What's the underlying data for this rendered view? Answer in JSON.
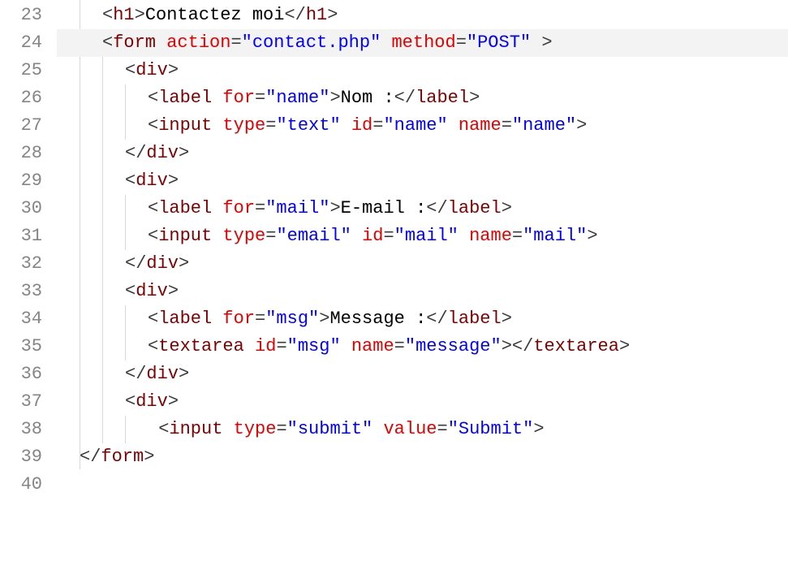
{
  "gutter": {
    "start": 23,
    "end": 40
  },
  "highlightedLine": 24,
  "guideOffsets": [
    28,
    56,
    84,
    112
  ],
  "lines": [
    {
      "n": 23,
      "indent": 2,
      "guides": [
        1
      ],
      "tokens": [
        {
          "c": "punct",
          "t": "<"
        },
        {
          "c": "tag",
          "t": "h1"
        },
        {
          "c": "punct",
          "t": ">"
        },
        {
          "c": "text",
          "t": "Contactez moi"
        },
        {
          "c": "punct",
          "t": "</"
        },
        {
          "c": "tag",
          "t": "h1"
        },
        {
          "c": "punct",
          "t": ">"
        }
      ]
    },
    {
      "n": 24,
      "indent": 2,
      "guides": [
        1
      ],
      "hl": true,
      "tokens": [
        {
          "c": "punct",
          "t": "<"
        },
        {
          "c": "tag",
          "t": "form"
        },
        {
          "c": "text",
          "t": " "
        },
        {
          "c": "attr",
          "t": "action"
        },
        {
          "c": "punct",
          "t": "="
        },
        {
          "c": "str",
          "t": "\"contact.php\""
        },
        {
          "c": "text",
          "t": " "
        },
        {
          "c": "attr",
          "t": "method"
        },
        {
          "c": "punct",
          "t": "="
        },
        {
          "c": "str",
          "t": "\"POST\""
        },
        {
          "c": "text",
          "t": " "
        },
        {
          "c": "punct",
          "t": ">"
        }
      ]
    },
    {
      "n": 25,
      "indent": 3,
      "guides": [
        1,
        2
      ],
      "tokens": [
        {
          "c": "punct",
          "t": "<"
        },
        {
          "c": "tag",
          "t": "div"
        },
        {
          "c": "punct",
          "t": ">"
        }
      ]
    },
    {
      "n": 26,
      "indent": 4,
      "guides": [
        1,
        2,
        3
      ],
      "tokens": [
        {
          "c": "punct",
          "t": "<"
        },
        {
          "c": "tag",
          "t": "label"
        },
        {
          "c": "text",
          "t": " "
        },
        {
          "c": "attr",
          "t": "for"
        },
        {
          "c": "punct",
          "t": "="
        },
        {
          "c": "str",
          "t": "\"name\""
        },
        {
          "c": "punct",
          "t": ">"
        },
        {
          "c": "text",
          "t": "Nom :"
        },
        {
          "c": "punct",
          "t": "</"
        },
        {
          "c": "tag",
          "t": "label"
        },
        {
          "c": "punct",
          "t": ">"
        }
      ]
    },
    {
      "n": 27,
      "indent": 4,
      "guides": [
        1,
        2,
        3
      ],
      "tokens": [
        {
          "c": "punct",
          "t": "<"
        },
        {
          "c": "tag",
          "t": "input"
        },
        {
          "c": "text",
          "t": " "
        },
        {
          "c": "attr",
          "t": "type"
        },
        {
          "c": "punct",
          "t": "="
        },
        {
          "c": "str",
          "t": "\"text\""
        },
        {
          "c": "text",
          "t": " "
        },
        {
          "c": "attr",
          "t": "id"
        },
        {
          "c": "punct",
          "t": "="
        },
        {
          "c": "str",
          "t": "\"name\""
        },
        {
          "c": "text",
          "t": " "
        },
        {
          "c": "attr",
          "t": "name"
        },
        {
          "c": "punct",
          "t": "="
        },
        {
          "c": "str",
          "t": "\"name\""
        },
        {
          "c": "punct",
          "t": ">"
        }
      ]
    },
    {
      "n": 28,
      "indent": 3,
      "guides": [
        1,
        2
      ],
      "tokens": [
        {
          "c": "punct",
          "t": "</"
        },
        {
          "c": "tag",
          "t": "div"
        },
        {
          "c": "punct",
          "t": ">"
        }
      ]
    },
    {
      "n": 29,
      "indent": 3,
      "guides": [
        1,
        2
      ],
      "tokens": [
        {
          "c": "punct",
          "t": "<"
        },
        {
          "c": "tag",
          "t": "div"
        },
        {
          "c": "punct",
          "t": ">"
        }
      ]
    },
    {
      "n": 30,
      "indent": 4,
      "guides": [
        1,
        2,
        3
      ],
      "tokens": [
        {
          "c": "punct",
          "t": "<"
        },
        {
          "c": "tag",
          "t": "label"
        },
        {
          "c": "text",
          "t": " "
        },
        {
          "c": "attr",
          "t": "for"
        },
        {
          "c": "punct",
          "t": "="
        },
        {
          "c": "str",
          "t": "\"mail\""
        },
        {
          "c": "punct",
          "t": ">"
        },
        {
          "c": "text",
          "t": "E-mail :"
        },
        {
          "c": "punct",
          "t": "</"
        },
        {
          "c": "tag",
          "t": "label"
        },
        {
          "c": "punct",
          "t": ">"
        }
      ]
    },
    {
      "n": 31,
      "indent": 4,
      "guides": [
        1,
        2,
        3
      ],
      "tokens": [
        {
          "c": "punct",
          "t": "<"
        },
        {
          "c": "tag",
          "t": "input"
        },
        {
          "c": "text",
          "t": " "
        },
        {
          "c": "attr",
          "t": "type"
        },
        {
          "c": "punct",
          "t": "="
        },
        {
          "c": "str",
          "t": "\"email\""
        },
        {
          "c": "text",
          "t": " "
        },
        {
          "c": "attr",
          "t": "id"
        },
        {
          "c": "punct",
          "t": "="
        },
        {
          "c": "str",
          "t": "\"mail\""
        },
        {
          "c": "text",
          "t": " "
        },
        {
          "c": "attr",
          "t": "name"
        },
        {
          "c": "punct",
          "t": "="
        },
        {
          "c": "str",
          "t": "\"mail\""
        },
        {
          "c": "punct",
          "t": ">"
        }
      ]
    },
    {
      "n": 32,
      "indent": 3,
      "guides": [
        1,
        2
      ],
      "tokens": [
        {
          "c": "punct",
          "t": "</"
        },
        {
          "c": "tag",
          "t": "div"
        },
        {
          "c": "punct",
          "t": ">"
        }
      ]
    },
    {
      "n": 33,
      "indent": 3,
      "guides": [
        1,
        2
      ],
      "tokens": [
        {
          "c": "punct",
          "t": "<"
        },
        {
          "c": "tag",
          "t": "div"
        },
        {
          "c": "punct",
          "t": ">"
        }
      ]
    },
    {
      "n": 34,
      "indent": 4,
      "guides": [
        1,
        2,
        3
      ],
      "tokens": [
        {
          "c": "punct",
          "t": "<"
        },
        {
          "c": "tag",
          "t": "label"
        },
        {
          "c": "text",
          "t": " "
        },
        {
          "c": "attr",
          "t": "for"
        },
        {
          "c": "punct",
          "t": "="
        },
        {
          "c": "str",
          "t": "\"msg\""
        },
        {
          "c": "punct",
          "t": ">"
        },
        {
          "c": "text",
          "t": "Message :"
        },
        {
          "c": "punct",
          "t": "</"
        },
        {
          "c": "tag",
          "t": "label"
        },
        {
          "c": "punct",
          "t": ">"
        }
      ]
    },
    {
      "n": 35,
      "indent": 4,
      "guides": [
        1,
        2,
        3
      ],
      "tokens": [
        {
          "c": "punct",
          "t": "<"
        },
        {
          "c": "tag",
          "t": "textarea"
        },
        {
          "c": "text",
          "t": " "
        },
        {
          "c": "attr",
          "t": "id"
        },
        {
          "c": "punct",
          "t": "="
        },
        {
          "c": "str",
          "t": "\"msg\""
        },
        {
          "c": "text",
          "t": " "
        },
        {
          "c": "attr",
          "t": "name"
        },
        {
          "c": "punct",
          "t": "="
        },
        {
          "c": "str",
          "t": "\"message\""
        },
        {
          "c": "punct",
          "t": ">"
        },
        {
          "c": "punct",
          "t": "</"
        },
        {
          "c": "tag",
          "t": "textarea"
        },
        {
          "c": "punct",
          "t": ">"
        }
      ]
    },
    {
      "n": 36,
      "indent": 3,
      "guides": [
        1,
        2
      ],
      "tokens": [
        {
          "c": "punct",
          "t": "</"
        },
        {
          "c": "tag",
          "t": "div"
        },
        {
          "c": "punct",
          "t": ">"
        }
      ]
    },
    {
      "n": 37,
      "indent": 3,
      "guides": [
        1,
        2
      ],
      "tokens": [
        {
          "c": "punct",
          "t": "<"
        },
        {
          "c": "tag",
          "t": "div"
        },
        {
          "c": "punct",
          "t": ">"
        }
      ]
    },
    {
      "n": 38,
      "indent": 4,
      "guides": [
        1,
        2,
        3
      ],
      "tokens": [
        {
          "c": "text",
          "t": " "
        },
        {
          "c": "punct",
          "t": "<"
        },
        {
          "c": "tag",
          "t": "input"
        },
        {
          "c": "text",
          "t": " "
        },
        {
          "c": "attr",
          "t": "type"
        },
        {
          "c": "punct",
          "t": "="
        },
        {
          "c": "str",
          "t": "\"submit\""
        },
        {
          "c": "text",
          "t": " "
        },
        {
          "c": "attr",
          "t": "value"
        },
        {
          "c": "punct",
          "t": "="
        },
        {
          "c": "str",
          "t": "\"Submit\""
        },
        {
          "c": "punct",
          "t": ">"
        }
      ]
    },
    {
      "n": 39,
      "indent": 1,
      "guides": [],
      "tokens": [
        {
          "c": "punct",
          "t": "</"
        },
        {
          "c": "tag",
          "t": "form"
        },
        {
          "c": "punct",
          "t": ">"
        }
      ]
    },
    {
      "n": 40,
      "indent": 0,
      "guides": [],
      "tokens": []
    }
  ]
}
